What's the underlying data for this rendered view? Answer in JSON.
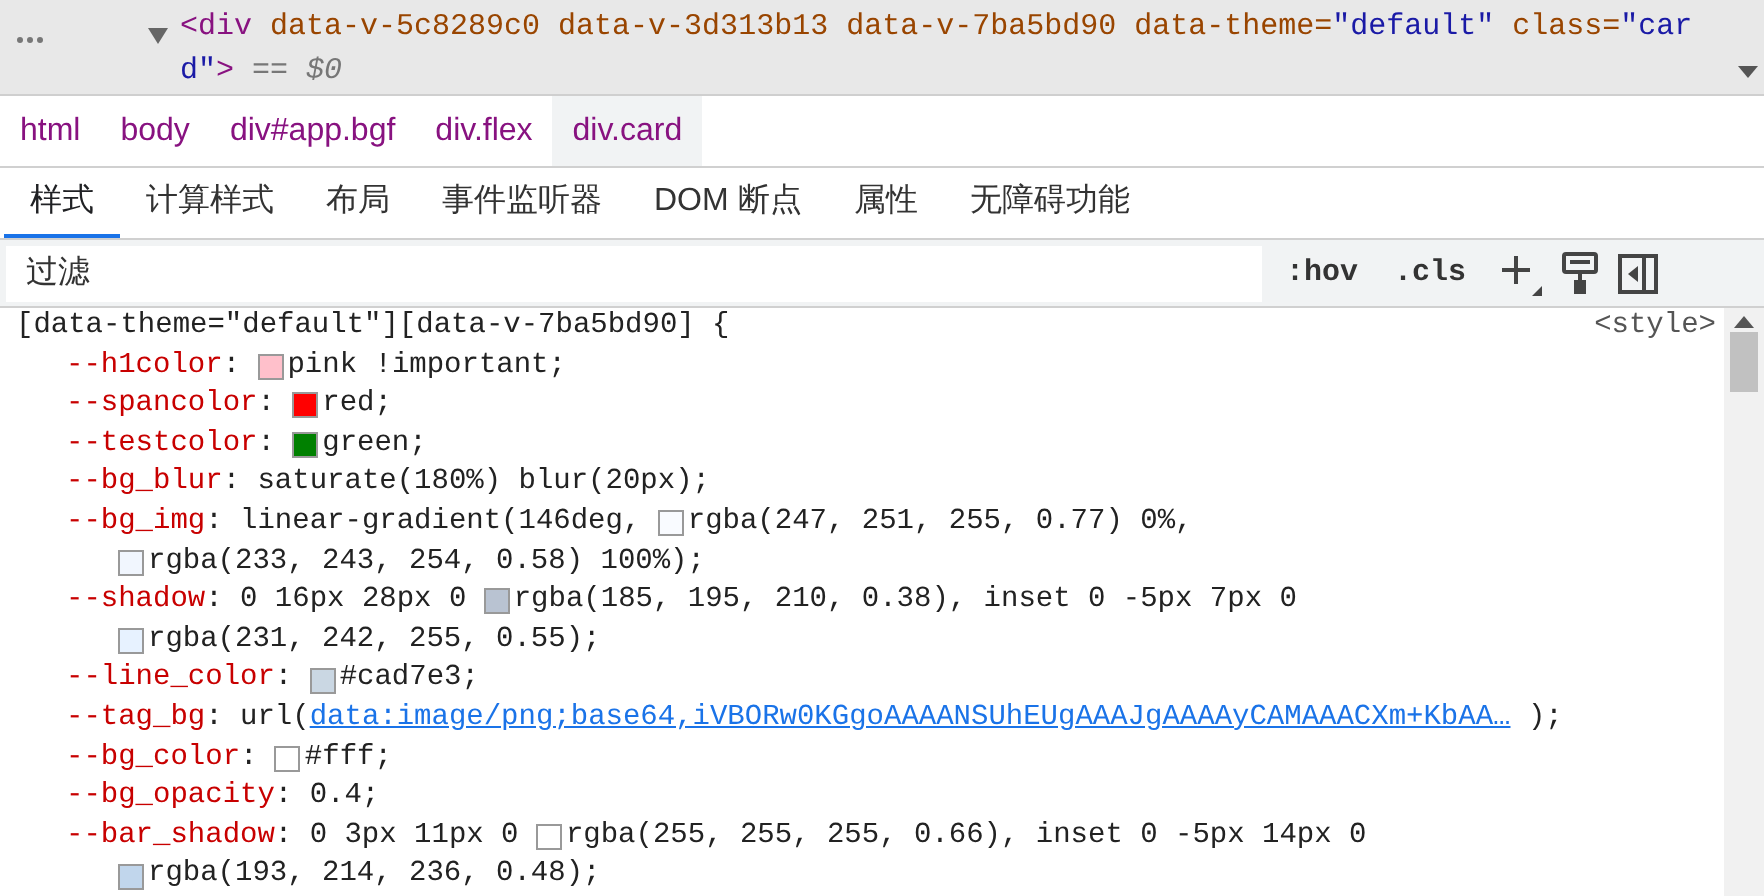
{
  "element": {
    "lines": [
      [
        {
          "kind": "tag",
          "text": "<div"
        },
        {
          "kind": "attr",
          "text": " data-v-5c8289c0"
        },
        {
          "kind": "attr",
          "text": " data-v-3d313b13"
        },
        {
          "kind": "attr",
          "text": " data-v-7ba5bd90"
        },
        {
          "kind": "attr",
          "text": " data-theme="
        },
        {
          "kind": "value",
          "text": "\"default\""
        },
        {
          "kind": "attr",
          "text": " class="
        },
        {
          "kind": "value",
          "text": "\"car"
        }
      ],
      [
        {
          "kind": "value",
          "text": "d\""
        },
        {
          "kind": "tag",
          "text": ">"
        },
        {
          "kind": "hint",
          "text": " == $0"
        }
      ]
    ]
  },
  "breadcrumbs": [
    {
      "label": "html",
      "selected": false
    },
    {
      "label": "body",
      "selected": false
    },
    {
      "label": "div#app.bgf",
      "selected": false
    },
    {
      "label": "div.flex",
      "selected": false
    },
    {
      "label": "div.card",
      "selected": true
    }
  ],
  "tabs": [
    {
      "label": "样式",
      "selected": true
    },
    {
      "label": "计算样式",
      "selected": false
    },
    {
      "label": "布局",
      "selected": false
    },
    {
      "label": "事件监听器",
      "selected": false
    },
    {
      "label": "DOM 断点",
      "selected": false
    },
    {
      "label": "属性",
      "selected": false
    },
    {
      "label": "无障碍功能",
      "selected": false
    }
  ],
  "filter": {
    "placeholder": "过滤",
    "buttons": [
      ":hov",
      ".cls"
    ]
  },
  "rule": {
    "selector": "[data-theme=\"default\"][data-v-7ba5bd90] {",
    "source": "<style>",
    "separator": ":",
    "declarations": [
      {
        "name": "--h1color",
        "lines": [
          [
            {
              "kind": "swatch",
              "color": "#ffc0cb"
            },
            {
              "kind": "text",
              "text": "pink !important;"
            }
          ]
        ]
      },
      {
        "name": "--spancolor",
        "lines": [
          [
            {
              "kind": "swatch",
              "color": "#ff0000"
            },
            {
              "kind": "text",
              "text": "red;"
            }
          ]
        ]
      },
      {
        "name": "--testcolor",
        "lines": [
          [
            {
              "kind": "swatch",
              "color": "#008000"
            },
            {
              "kind": "text",
              "text": "green;"
            }
          ]
        ]
      },
      {
        "name": "--bg_blur",
        "lines": [
          [
            {
              "kind": "text",
              "text": "saturate(180%) blur(20px);"
            }
          ]
        ]
      },
      {
        "name": "--bg_img",
        "lines": [
          [
            {
              "kind": "text",
              "text": "linear-gradient(146deg, "
            },
            {
              "kind": "swatch",
              "color": "#f9fbff"
            },
            {
              "kind": "text",
              "text": "rgba(247, 251, 255, 0.77) 0%,"
            }
          ],
          [
            {
              "kind": "swatch",
              "color": "#f1f6fe"
            },
            {
              "kind": "text",
              "text": "rgba(233, 243, 254, 0.58) 100%);"
            }
          ]
        ]
      },
      {
        "name": "--shadow",
        "lines": [
          [
            {
              "kind": "text",
              "text": "0 16px 28px 0 "
            },
            {
              "kind": "swatch",
              "color": "#b9c3d2"
            },
            {
              "kind": "text",
              "text": "rgba(185, 195, 210, 0.38), inset 0 -5px 7px 0"
            }
          ],
          [
            {
              "kind": "swatch",
              "color": "#e7f2ff"
            },
            {
              "kind": "text",
              "text": "rgba(231, 242, 255, 0.55);"
            }
          ]
        ]
      },
      {
        "name": "--line_color",
        "lines": [
          [
            {
              "kind": "swatch",
              "color": "#cad7e3"
            },
            {
              "kind": "text",
              "text": "#cad7e3;"
            }
          ]
        ]
      },
      {
        "name": "--tag_bg",
        "lines": [
          [
            {
              "kind": "text",
              "text": "url("
            },
            {
              "kind": "link",
              "text": "data:image/png;base64,iVBORw0KGgoAAAANSUhEUgAAAJgAAAAyCAMAAACXm+KbAA…"
            },
            {
              "kind": "text",
              "text": " );"
            }
          ]
        ]
      },
      {
        "name": "--bg_color",
        "lines": [
          [
            {
              "kind": "swatch",
              "color": "#ffffff"
            },
            {
              "kind": "text",
              "text": "#fff;"
            }
          ]
        ]
      },
      {
        "name": "--bg_opacity",
        "lines": [
          [
            {
              "kind": "text",
              "text": "0.4;"
            }
          ]
        ]
      },
      {
        "name": "--bar_shadow",
        "lines": [
          [
            {
              "kind": "text",
              "text": "0 3px 11px 0 "
            },
            {
              "kind": "swatch",
              "color": "#ffffff"
            },
            {
              "kind": "text",
              "text": "rgba(255, 255, 255, 0.66), inset 0 -5px 14px 0"
            }
          ],
          [
            {
              "kind": "swatch",
              "color": "#c1d6ec"
            },
            {
              "kind": "text",
              "text": "rgba(193, 214, 236, 0.48);"
            }
          ]
        ]
      }
    ]
  }
}
